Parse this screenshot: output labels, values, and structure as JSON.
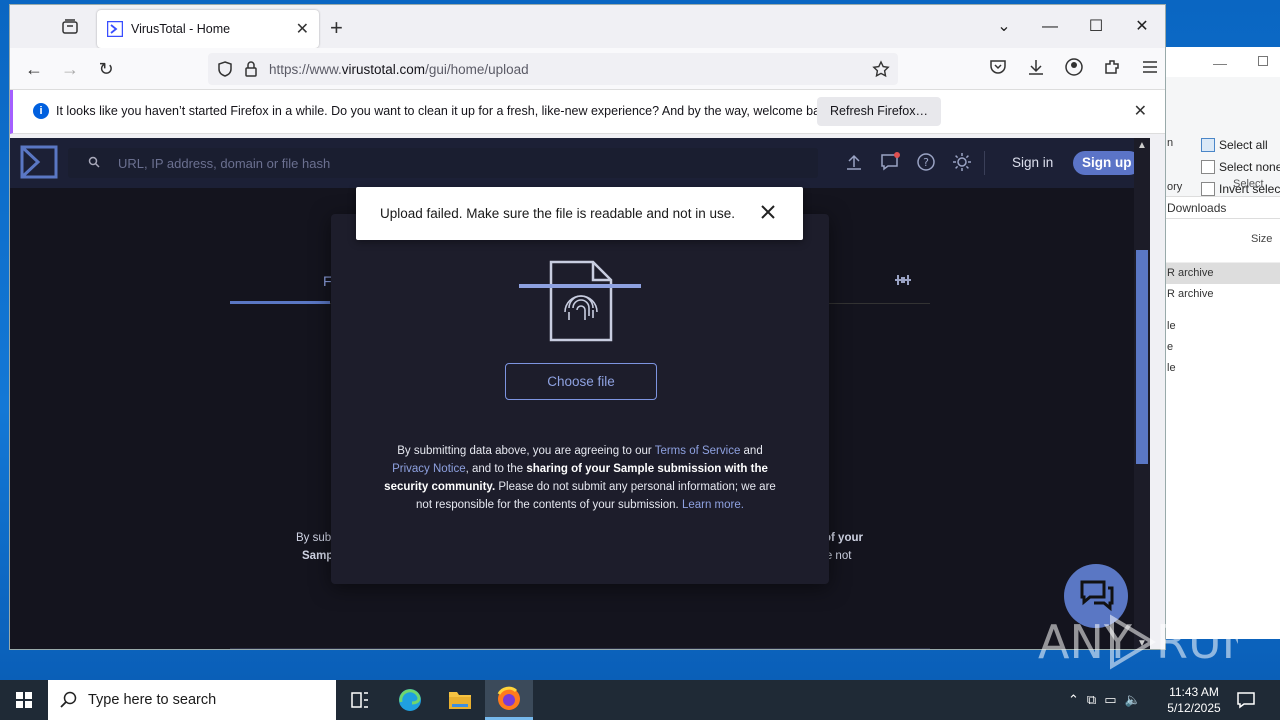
{
  "browser": {
    "tab_title": "VirusTotal - Home",
    "url_prefix": "https://www.",
    "url_domain": "virustotal.com",
    "url_path": "/gui/home/upload"
  },
  "notification": {
    "message": "It looks like you haven’t started Firefox in a while. Do you want to clean it up for a fresh, like-new experience? And by the way, welcome back!",
    "refresh_label": "Refresh Firefox…"
  },
  "vt": {
    "search_placeholder": "URL, IP address, domain or file hash",
    "signin": "Sign in",
    "signup": "Sign up",
    "bg_tab_letter": "F",
    "bg_text_left_1": "By sub",
    "bg_text_left_2": "Samp",
    "bg_text_right_1": "of your",
    "bg_text_right_2": "re not"
  },
  "modal": {
    "choose_file": "Choose file",
    "terms_prefix": "By submitting data above, you are agreeing to our ",
    "terms_link": "Terms of Service",
    "terms_and": " and ",
    "privacy_link": "Privacy Notice",
    "terms_mid": ", and to the ",
    "terms_bold": "sharing of your Sample submission with the security community.",
    "terms_suffix": " Please do not submit any personal information; we are not responsible for the contents of your submission. ",
    "learn_more": "Learn more."
  },
  "toast": {
    "message": "Upload failed. Make sure the file is readable and not in use."
  },
  "explorer": {
    "select_all": "Select all",
    "select_none": "Select none",
    "invert_selection": "Invert selection",
    "select_group": "Select",
    "left_frag_1": "n",
    "left_frag_2": "ory",
    "path_frag": "Downloads",
    "col_size": "Size",
    "rows": [
      "R archive",
      "R archive",
      "le",
      "e",
      "le"
    ]
  },
  "taskbar": {
    "search_placeholder": "Type here to search",
    "time": "11:43 AM",
    "date": "5/12/2025"
  },
  "watermark": "ANY RUN"
}
